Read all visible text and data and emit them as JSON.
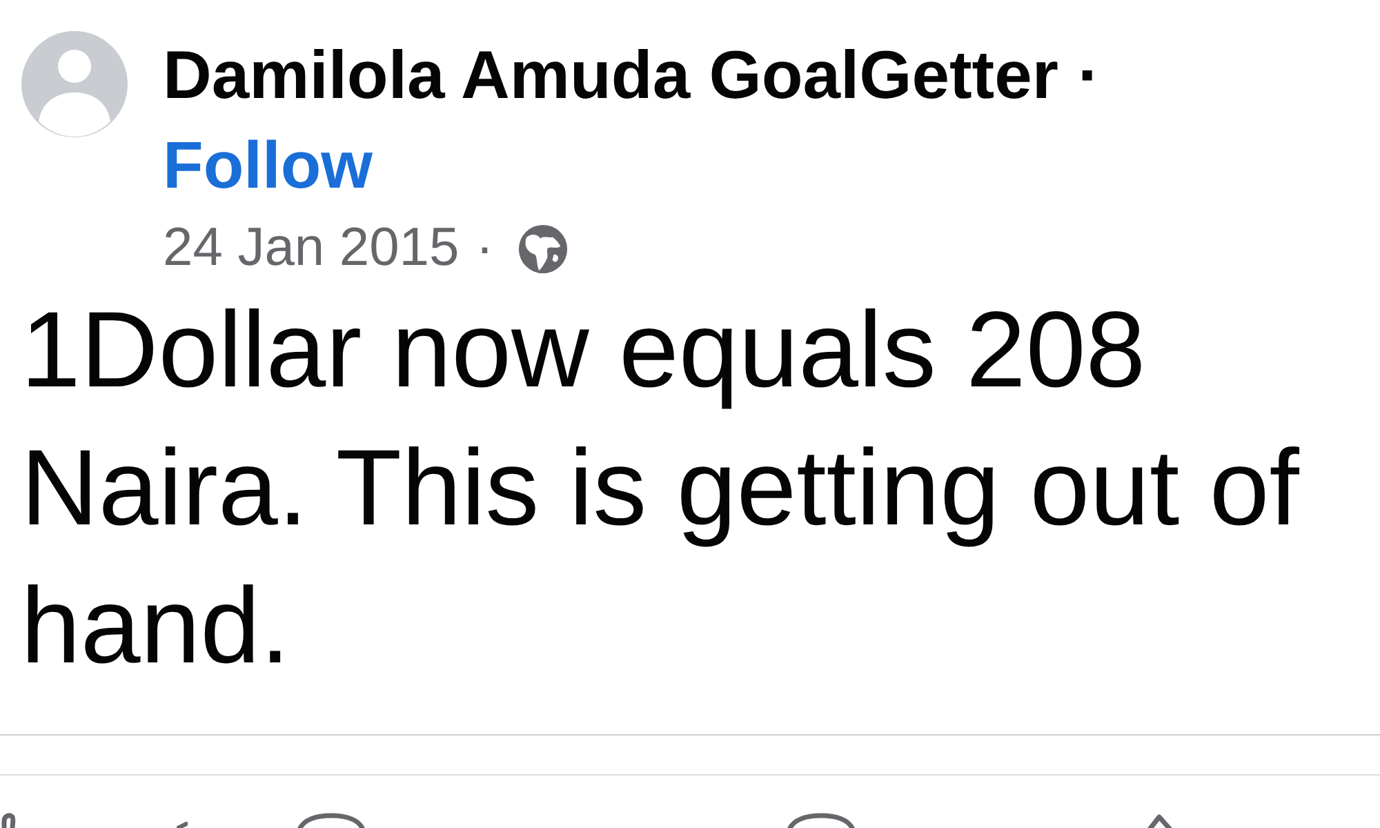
{
  "post": {
    "author": {
      "name": "Damilola Amuda GoalGetter",
      "separator": "·",
      "follow_label": "Follow"
    },
    "meta": {
      "date": "24 Jan 2015",
      "separator": "·"
    },
    "text": "1Dollar now equals 208 Naira. This is getting out of hand."
  }
}
